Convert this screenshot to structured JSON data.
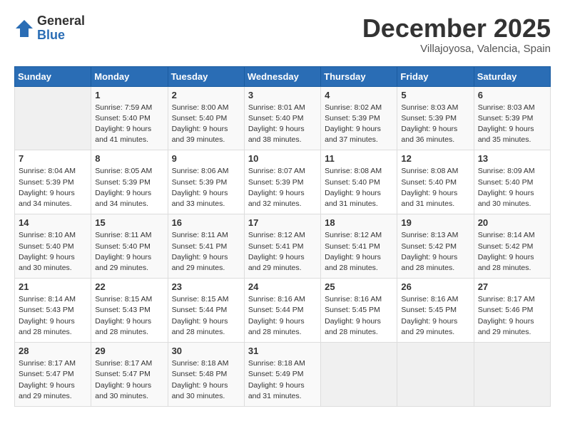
{
  "logo": {
    "general": "General",
    "blue": "Blue"
  },
  "header": {
    "month": "December 2025",
    "location": "Villajoyosa, Valencia, Spain"
  },
  "days_of_week": [
    "Sunday",
    "Monday",
    "Tuesday",
    "Wednesday",
    "Thursday",
    "Friday",
    "Saturday"
  ],
  "weeks": [
    [
      {
        "day": "",
        "info": ""
      },
      {
        "day": "1",
        "info": "Sunrise: 7:59 AM\nSunset: 5:40 PM\nDaylight: 9 hours\nand 41 minutes."
      },
      {
        "day": "2",
        "info": "Sunrise: 8:00 AM\nSunset: 5:40 PM\nDaylight: 9 hours\nand 39 minutes."
      },
      {
        "day": "3",
        "info": "Sunrise: 8:01 AM\nSunset: 5:40 PM\nDaylight: 9 hours\nand 38 minutes."
      },
      {
        "day": "4",
        "info": "Sunrise: 8:02 AM\nSunset: 5:39 PM\nDaylight: 9 hours\nand 37 minutes."
      },
      {
        "day": "5",
        "info": "Sunrise: 8:03 AM\nSunset: 5:39 PM\nDaylight: 9 hours\nand 36 minutes."
      },
      {
        "day": "6",
        "info": "Sunrise: 8:03 AM\nSunset: 5:39 PM\nDaylight: 9 hours\nand 35 minutes."
      }
    ],
    [
      {
        "day": "7",
        "info": "Sunrise: 8:04 AM\nSunset: 5:39 PM\nDaylight: 9 hours\nand 34 minutes."
      },
      {
        "day": "8",
        "info": "Sunrise: 8:05 AM\nSunset: 5:39 PM\nDaylight: 9 hours\nand 34 minutes."
      },
      {
        "day": "9",
        "info": "Sunrise: 8:06 AM\nSunset: 5:39 PM\nDaylight: 9 hours\nand 33 minutes."
      },
      {
        "day": "10",
        "info": "Sunrise: 8:07 AM\nSunset: 5:39 PM\nDaylight: 9 hours\nand 32 minutes."
      },
      {
        "day": "11",
        "info": "Sunrise: 8:08 AM\nSunset: 5:40 PM\nDaylight: 9 hours\nand 31 minutes."
      },
      {
        "day": "12",
        "info": "Sunrise: 8:08 AM\nSunset: 5:40 PM\nDaylight: 9 hours\nand 31 minutes."
      },
      {
        "day": "13",
        "info": "Sunrise: 8:09 AM\nSunset: 5:40 PM\nDaylight: 9 hours\nand 30 minutes."
      }
    ],
    [
      {
        "day": "14",
        "info": "Sunrise: 8:10 AM\nSunset: 5:40 PM\nDaylight: 9 hours\nand 30 minutes."
      },
      {
        "day": "15",
        "info": "Sunrise: 8:11 AM\nSunset: 5:40 PM\nDaylight: 9 hours\nand 29 minutes."
      },
      {
        "day": "16",
        "info": "Sunrise: 8:11 AM\nSunset: 5:41 PM\nDaylight: 9 hours\nand 29 minutes."
      },
      {
        "day": "17",
        "info": "Sunrise: 8:12 AM\nSunset: 5:41 PM\nDaylight: 9 hours\nand 29 minutes."
      },
      {
        "day": "18",
        "info": "Sunrise: 8:12 AM\nSunset: 5:41 PM\nDaylight: 9 hours\nand 28 minutes."
      },
      {
        "day": "19",
        "info": "Sunrise: 8:13 AM\nSunset: 5:42 PM\nDaylight: 9 hours\nand 28 minutes."
      },
      {
        "day": "20",
        "info": "Sunrise: 8:14 AM\nSunset: 5:42 PM\nDaylight: 9 hours\nand 28 minutes."
      }
    ],
    [
      {
        "day": "21",
        "info": "Sunrise: 8:14 AM\nSunset: 5:43 PM\nDaylight: 9 hours\nand 28 minutes."
      },
      {
        "day": "22",
        "info": "Sunrise: 8:15 AM\nSunset: 5:43 PM\nDaylight: 9 hours\nand 28 minutes."
      },
      {
        "day": "23",
        "info": "Sunrise: 8:15 AM\nSunset: 5:44 PM\nDaylight: 9 hours\nand 28 minutes."
      },
      {
        "day": "24",
        "info": "Sunrise: 8:16 AM\nSunset: 5:44 PM\nDaylight: 9 hours\nand 28 minutes."
      },
      {
        "day": "25",
        "info": "Sunrise: 8:16 AM\nSunset: 5:45 PM\nDaylight: 9 hours\nand 28 minutes."
      },
      {
        "day": "26",
        "info": "Sunrise: 8:16 AM\nSunset: 5:45 PM\nDaylight: 9 hours\nand 29 minutes."
      },
      {
        "day": "27",
        "info": "Sunrise: 8:17 AM\nSunset: 5:46 PM\nDaylight: 9 hours\nand 29 minutes."
      }
    ],
    [
      {
        "day": "28",
        "info": "Sunrise: 8:17 AM\nSunset: 5:47 PM\nDaylight: 9 hours\nand 29 minutes."
      },
      {
        "day": "29",
        "info": "Sunrise: 8:17 AM\nSunset: 5:47 PM\nDaylight: 9 hours\nand 30 minutes."
      },
      {
        "day": "30",
        "info": "Sunrise: 8:18 AM\nSunset: 5:48 PM\nDaylight: 9 hours\nand 30 minutes."
      },
      {
        "day": "31",
        "info": "Sunrise: 8:18 AM\nSunset: 5:49 PM\nDaylight: 9 hours\nand 31 minutes."
      },
      {
        "day": "",
        "info": ""
      },
      {
        "day": "",
        "info": ""
      },
      {
        "day": "",
        "info": ""
      }
    ]
  ]
}
